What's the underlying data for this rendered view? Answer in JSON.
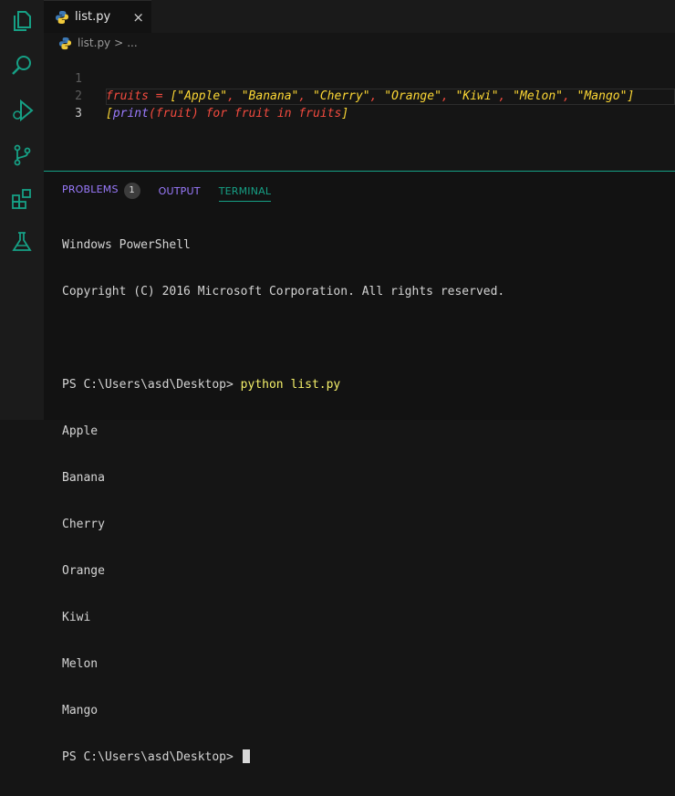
{
  "activity_bar": {
    "icons": [
      "explorer-icon",
      "search-icon",
      "debug-icon",
      "source-control-icon",
      "extensions-icon",
      "testing-icon"
    ]
  },
  "tab": {
    "filename": "list.py",
    "close": "×"
  },
  "breadcrumb": {
    "file": "list.py",
    "sep": ">",
    "more": "..."
  },
  "editor": {
    "lines": [
      {
        "num": "1"
      },
      {
        "num": "2"
      },
      {
        "num": "3"
      }
    ],
    "line1": {
      "var": "fruits",
      "op": " = ",
      "open": "[",
      "s1": "\"Apple\"",
      "c1": ", ",
      "s2": "\"Banana\"",
      "c2": ", ",
      "s3": "\"Cherry\"",
      "c3": ", ",
      "s4": "\"Orange\"",
      "c4": ", ",
      "s5": "\"Kiwi\"",
      "c5": ", ",
      "s6": "\"Melon\"",
      "c6": ", ",
      "s7": "\"Mango\"",
      "close": "]"
    },
    "line2": {
      "open": "[",
      "fn": "print",
      "paren_open": "(",
      "arg": "fruit",
      "paren_close": ")",
      "for_kw": " for ",
      "var": "fruit",
      "in_kw": " in ",
      "iter": "fruits",
      "close": "]"
    }
  },
  "panel": {
    "tabs": {
      "problems": "PROBLEMS",
      "problems_count": "1",
      "output": "OUTPUT",
      "terminal": "TERMINAL"
    }
  },
  "terminal": {
    "header1": "Windows PowerShell",
    "header2": "Copyright (C) 2016 Microsoft Corporation. All rights reserved.",
    "prompt": "PS C:\\Users\\asd\\Desktop> ",
    "command": "python list.py",
    "outputs": [
      "Apple",
      "Banana",
      "Cherry",
      "Orange",
      "Kiwi",
      "Melon",
      "Mango"
    ]
  },
  "colors": {
    "accent": "#16a085",
    "keyword": "#f44b3f",
    "string": "#fdd835",
    "function": "#9b7bff",
    "text_yellow": "#f5f06a"
  }
}
